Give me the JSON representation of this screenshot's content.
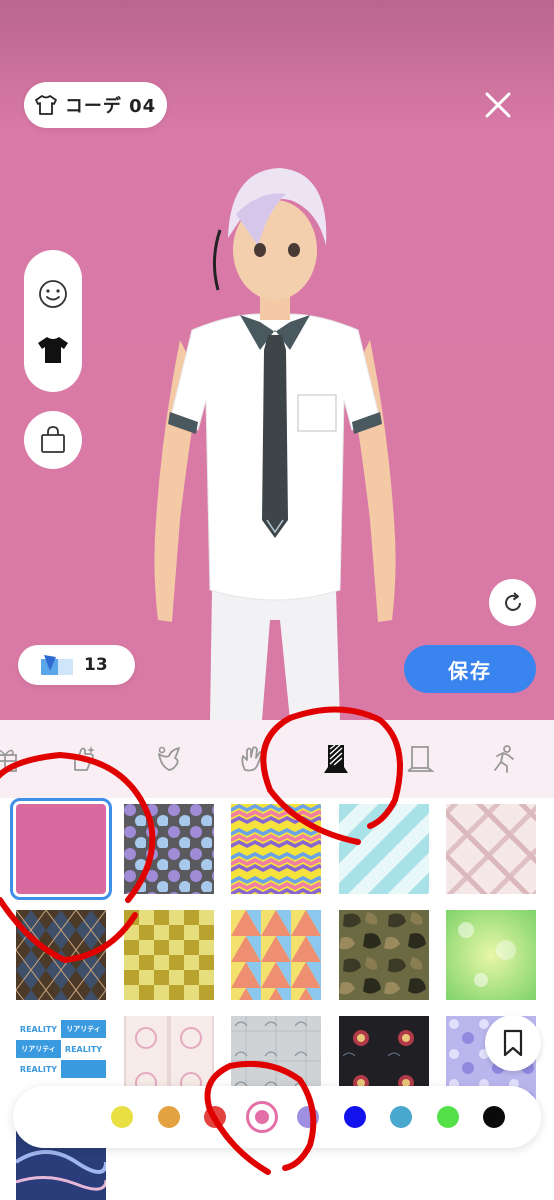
{
  "header": {
    "outfit_label": "コーデ 04"
  },
  "tickets": {
    "count": "13"
  },
  "actions": {
    "save_label": "保存"
  },
  "tabs": [
    "gift-icon",
    "sparkle-hand-icon",
    "wings-icon",
    "hand-icon",
    "background-icon",
    "book-icon",
    "pose-icon"
  ],
  "selected_tab": "background-icon",
  "swatches": [
    "solid-pink",
    "polka-dots",
    "zigzag",
    "diagonal-stripes",
    "plaid",
    "argyle",
    "checkerboard",
    "triangles",
    "camouflage",
    "bokeh-green",
    "reality-logo",
    "lace-pattern",
    "japanese-pattern-gray",
    "peony-black",
    "floral-lavender",
    "night-river"
  ],
  "selected_swatch": "solid-pink",
  "swatch_text": {
    "reality_en": "REALITY",
    "reality_jp": "リアリティ"
  },
  "colors": [
    "#e8df43",
    "#e3a13f",
    "#e44440",
    "#e36fa6",
    "#9e8fe0",
    "#1212ee",
    "#4aa8cf",
    "#55e04a",
    "#0a0a0a"
  ],
  "selected_color": "#e36fa6",
  "theme": {
    "save": "#3a84f0",
    "stage": "#d97aa6",
    "selection": "#3f8ee8"
  }
}
